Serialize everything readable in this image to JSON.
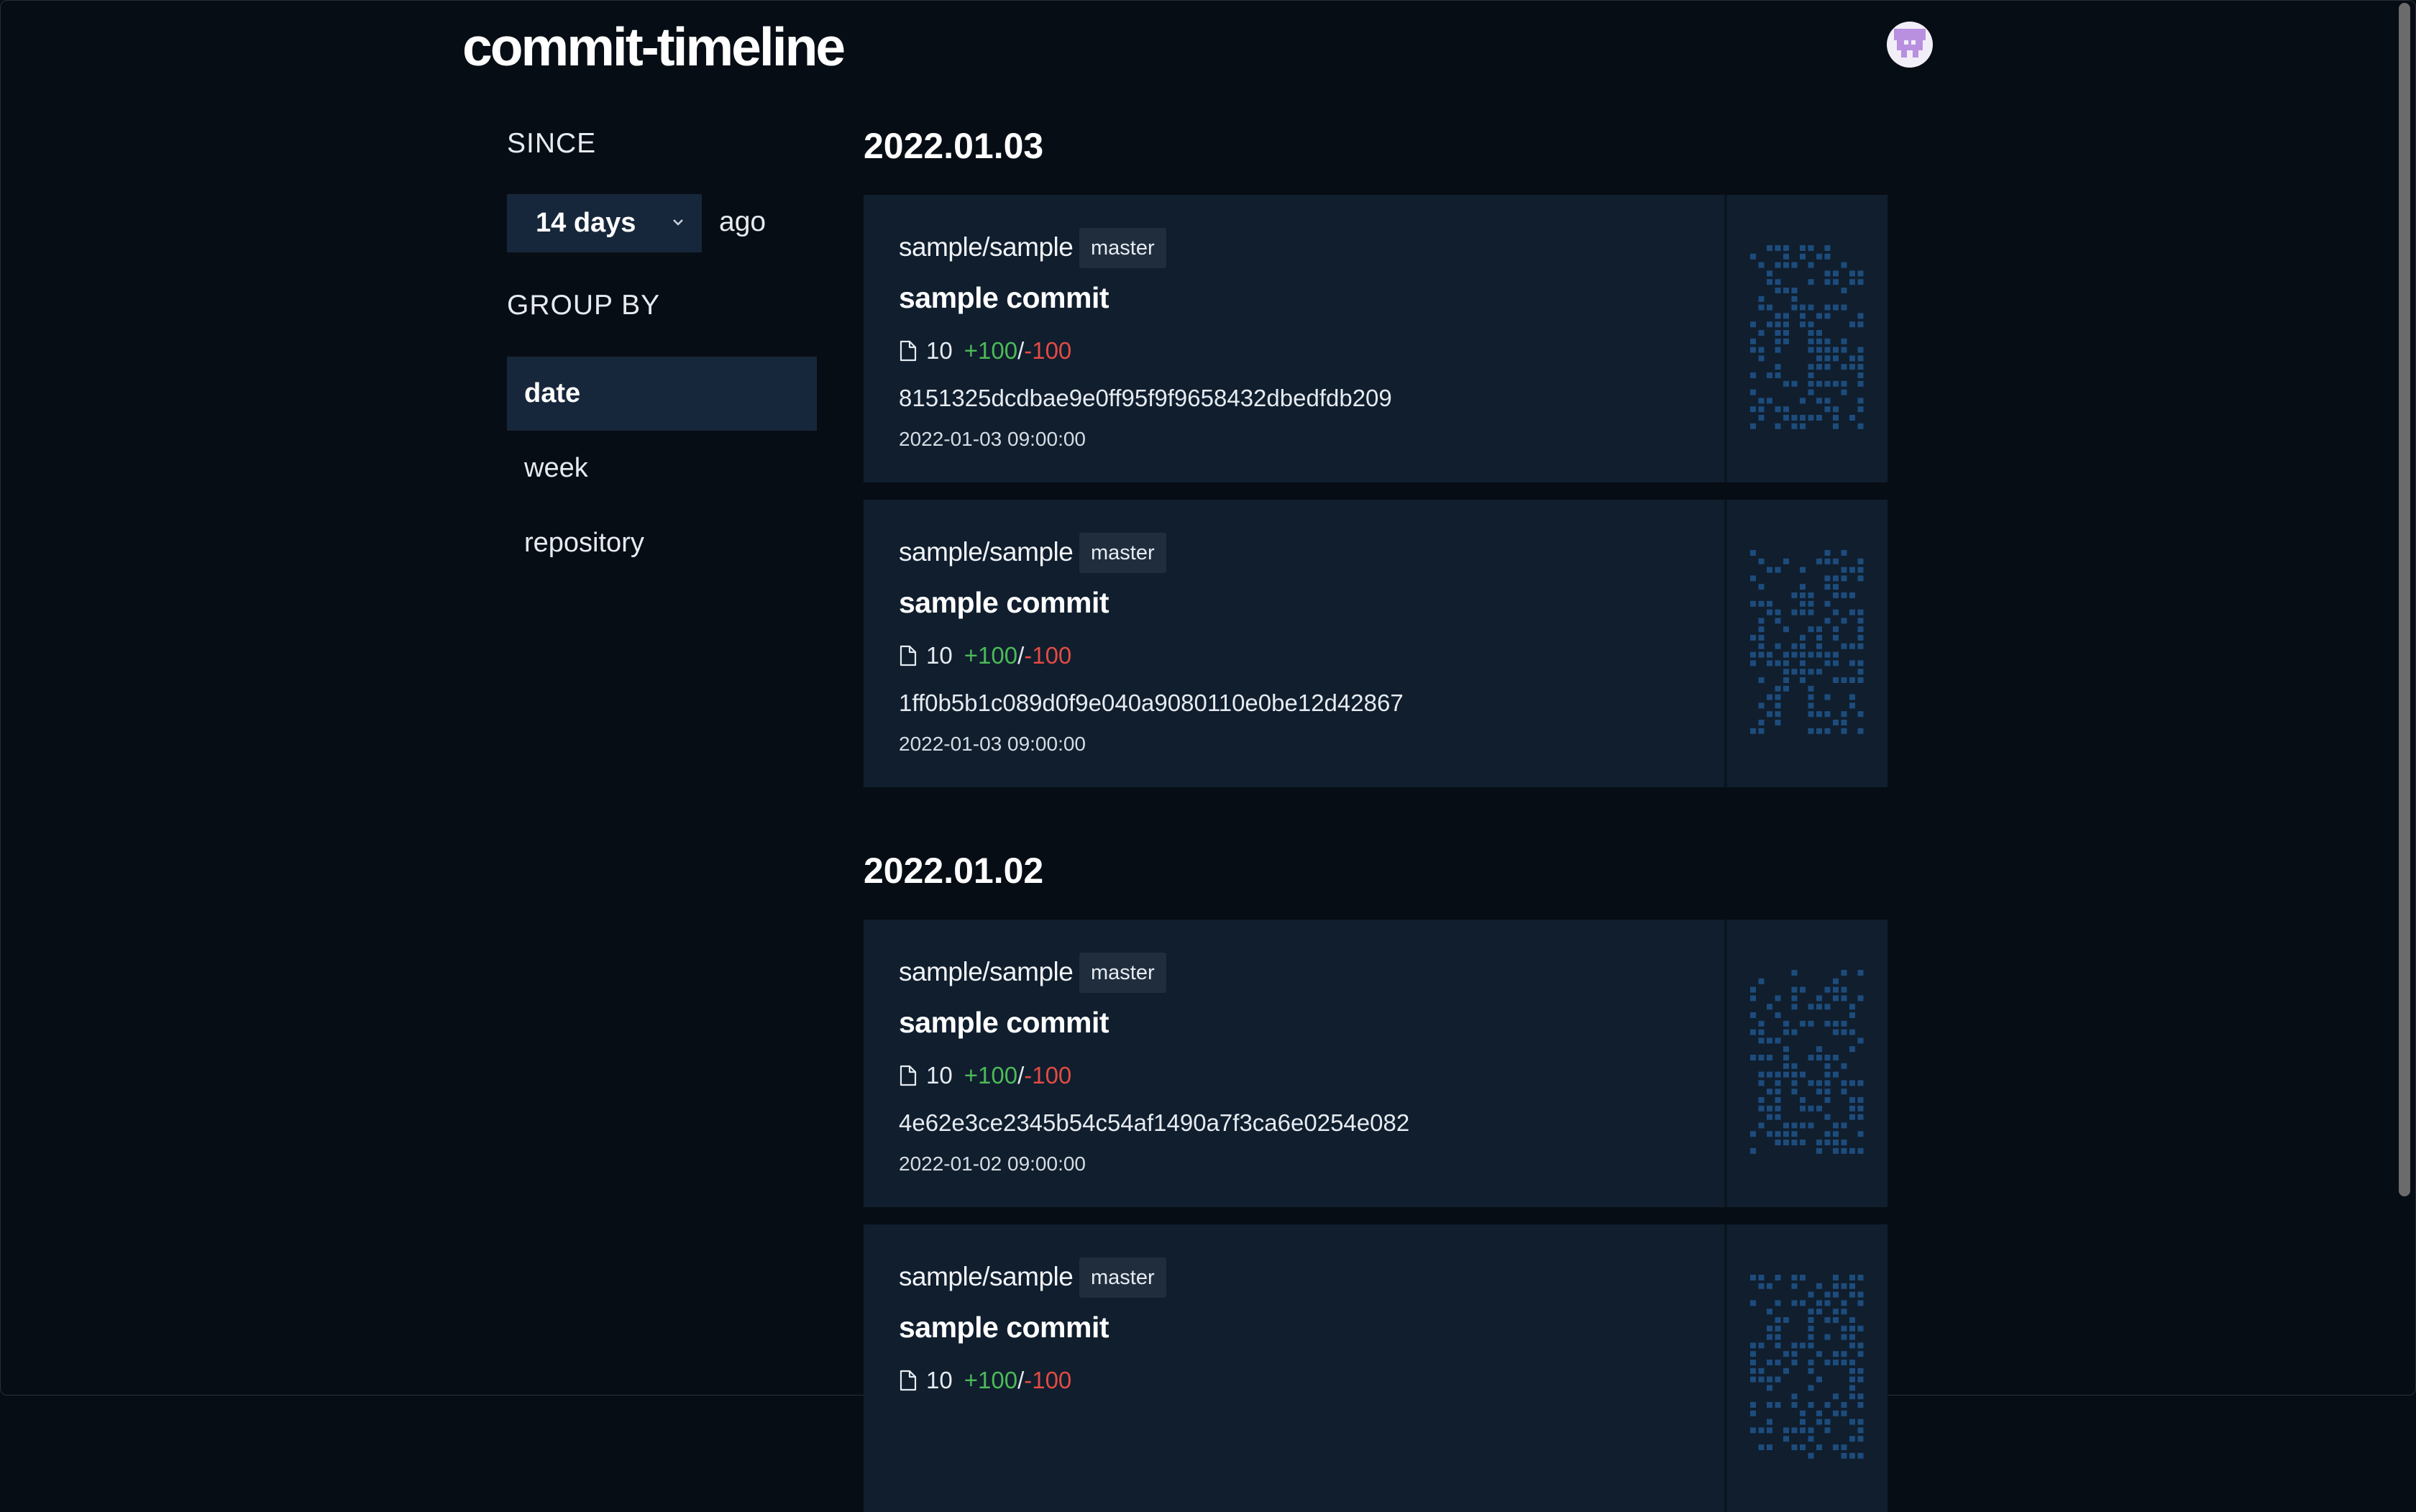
{
  "app": {
    "title": "commit-timeline"
  },
  "header": {
    "avatar_icon": "avatar-icon"
  },
  "sidebar": {
    "since_label": "SINCE",
    "since_value": "14 days",
    "since_suffix": "ago",
    "group_by_label": "GROUP BY",
    "group_by_options": [
      {
        "label": "date",
        "selected": true
      },
      {
        "label": "week",
        "selected": false
      },
      {
        "label": "repository",
        "selected": false
      }
    ]
  },
  "groups": [
    {
      "date": "2022.01.03",
      "commits": [
        {
          "repo": "sample/sample",
          "branch": "master",
          "message": "sample commit",
          "files": "10",
          "additions": "+100",
          "separator": "/",
          "deletions": "-100",
          "sha": "8151325dcdbae9e0ff95f9f9658432dbedfdb209",
          "timestamp": "2022-01-03 09:00:00"
        },
        {
          "repo": "sample/sample",
          "branch": "master",
          "message": "sample commit",
          "files": "10",
          "additions": "+100",
          "separator": "/",
          "deletions": "-100",
          "sha": "1ff0b5b1c089d0f9e040a9080110e0be12d42867",
          "timestamp": "2022-01-03 09:00:00"
        }
      ]
    },
    {
      "date": "2022.01.02",
      "commits": [
        {
          "repo": "sample/sample",
          "branch": "master",
          "message": "sample commit",
          "files": "10",
          "additions": "+100",
          "separator": "/",
          "deletions": "-100",
          "sha": "4e62e3ce2345b54c54af1490a7f3ca6e0254e082",
          "timestamp": "2022-01-02 09:00:00"
        },
        {
          "repo": "sample/sample",
          "branch": "master",
          "message": "sample commit",
          "files": "10",
          "additions": "+100",
          "separator": "/",
          "deletions": "-100"
        }
      ]
    }
  ],
  "colors": {
    "background": "#070d14",
    "card": "#101e2e",
    "selected": "#17273b",
    "additions": "#4cba58",
    "deletions": "#e34b43",
    "identicon": "#1d4c7c"
  }
}
